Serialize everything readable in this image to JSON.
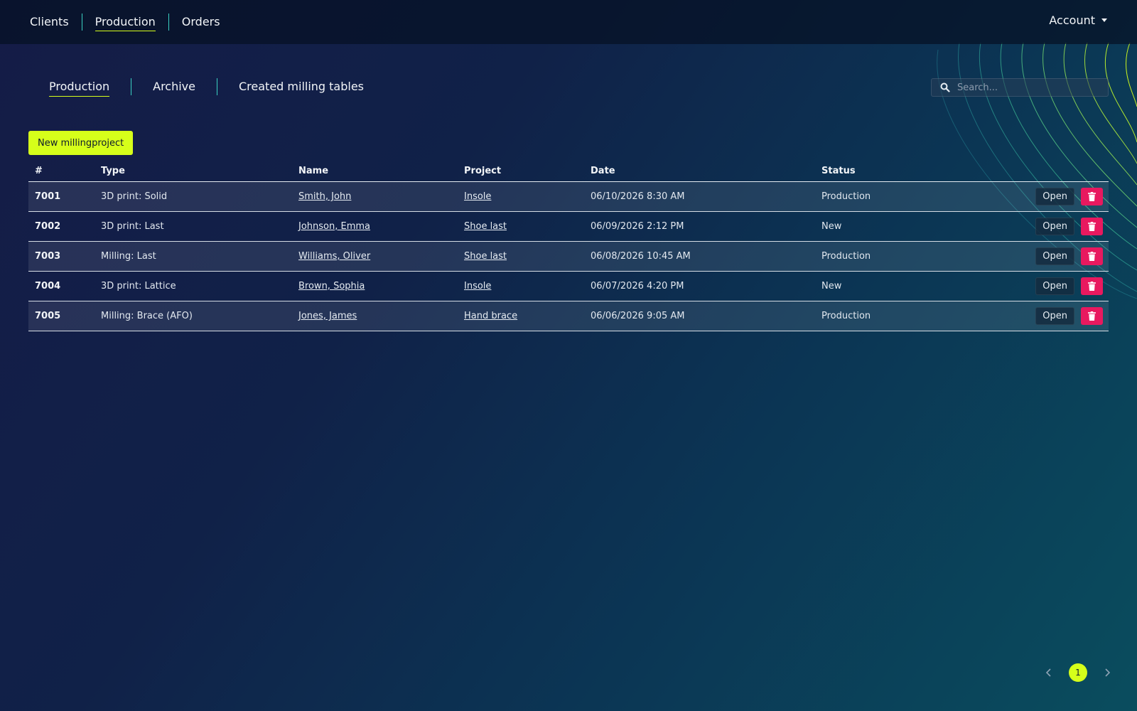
{
  "topnav": {
    "items": [
      {
        "label": "Clients"
      },
      {
        "label": "Production"
      },
      {
        "label": "Orders"
      }
    ],
    "account_label": "Account"
  },
  "subnav": {
    "items": [
      {
        "label": "Production"
      },
      {
        "label": "Archive"
      },
      {
        "label": "Created milling tables"
      }
    ]
  },
  "search": {
    "placeholder": "Search..."
  },
  "new_button_label": "New millingproject",
  "table": {
    "headers": {
      "num": "#",
      "type": "Type",
      "name": "Name",
      "project": "Project",
      "date": "Date",
      "status": "Status"
    },
    "open_label": "Open",
    "rows": [
      {
        "num": "7001",
        "type": "3D print: Solid",
        "name": "Smith, John",
        "project": "Insole",
        "date": "06/10/2026 8:30 AM",
        "status": "Production"
      },
      {
        "num": "7002",
        "type": "3D print: Last",
        "name": "Johnson, Emma",
        "project": "Shoe last",
        "date": "06/09/2026 2:12 PM",
        "status": "New"
      },
      {
        "num": "7003",
        "type": "Milling: Last",
        "name": "Williams, Oliver",
        "project": "Shoe last",
        "date": "06/08/2026 10:45 AM",
        "status": "Production"
      },
      {
        "num": "7004",
        "type": "3D print: Lattice",
        "name": "Brown, Sophia",
        "project": "Insole",
        "date": "06/07/2026 4:20 PM",
        "status": "New"
      },
      {
        "num": "7005",
        "type": "Milling: Brace (AFO)",
        "name": "Jones, James",
        "project": "Hand brace",
        "date": "06/06/2026 9:05 AM",
        "status": "Production"
      }
    ]
  },
  "pagination": {
    "current": "1"
  },
  "icons": {
    "search": "search-icon",
    "delete": "trash-icon",
    "prev": "chevron-left-icon",
    "next": "chevron-right-icon",
    "caret": "caret-down-icon"
  },
  "colors": {
    "accent": "#d6ff1a",
    "danger": "#e8195f",
    "separator": "#3ad1c2"
  }
}
